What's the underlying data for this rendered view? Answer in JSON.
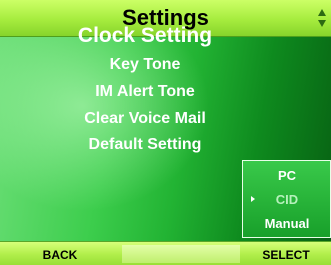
{
  "header": {
    "title": "Settings",
    "scroll_icon": "up-down-scroll-icon"
  },
  "menu": {
    "items": [
      {
        "label": "Clock Setting",
        "selected": true
      },
      {
        "label": "Key Tone"
      },
      {
        "label": "IM Alert Tone"
      },
      {
        "label": "Clear Voice Mail"
      },
      {
        "label": "Default Setting"
      }
    ]
  },
  "submenu": {
    "items": [
      {
        "label": "PC"
      },
      {
        "label": "CID",
        "highlighted": true
      },
      {
        "label": "Manual"
      }
    ],
    "pointer_icon": "right-triangle-icon"
  },
  "softkeys": {
    "left": "BACK",
    "right": "SELECT"
  },
  "colors": {
    "accent": "#a6ec3e",
    "background": "#22b333",
    "text": "#ffffff"
  }
}
